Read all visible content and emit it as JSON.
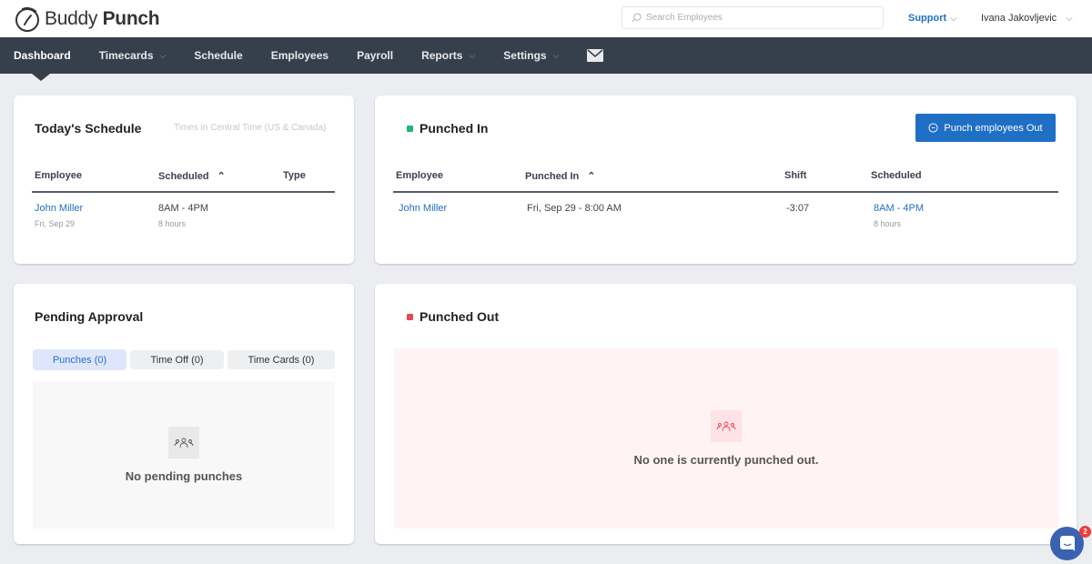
{
  "header": {
    "logo_light": "Buddy ",
    "logo_bold": "Punch",
    "search_placeholder": "Search Employees",
    "support_label": "Support",
    "user_name": "Ivana Jakovljevic"
  },
  "nav": {
    "items": [
      {
        "label": "Dashboard",
        "active": true,
        "dropdown": false
      },
      {
        "label": "Timecards",
        "dropdown": true
      },
      {
        "label": "Schedule",
        "dropdown": false
      },
      {
        "label": "Employees",
        "dropdown": false
      },
      {
        "label": "Payroll",
        "dropdown": false
      },
      {
        "label": "Reports",
        "dropdown": true
      },
      {
        "label": "Settings",
        "dropdown": true
      }
    ],
    "mail_icon": "envelope-icon"
  },
  "todays_schedule": {
    "title": "Today's Schedule",
    "timezone_note": "Times in Central Time (US & Canada)",
    "columns": [
      "Employee",
      "Scheduled",
      "Type"
    ],
    "rows": [
      {
        "employee": "John Miller",
        "date": "Fri, Sep 29",
        "scheduled": "8AM - 4PM",
        "duration": "8 hours",
        "type": ""
      }
    ]
  },
  "punched_in": {
    "title": "Punched In",
    "status_color": "#22b573",
    "button_label": "Punch employees Out",
    "columns": [
      "Employee",
      "Punched In",
      "Shift",
      "Scheduled"
    ],
    "rows": [
      {
        "employee": "John Miller",
        "punched_in": "Fri, Sep 29 - 8:00 AM",
        "shift": "-3:07",
        "scheduled": "8AM - 4PM",
        "duration": "8 hours"
      }
    ]
  },
  "pending_approval": {
    "title": "Pending Approval",
    "tabs": [
      {
        "label": "Punches (0)",
        "active": true
      },
      {
        "label": "Time Off (0)",
        "active": false
      },
      {
        "label": "Time Cards (0)",
        "active": false
      }
    ],
    "empty_text": "No pending punches"
  },
  "punched_out": {
    "title": "Punched Out",
    "status_color": "#e8475a",
    "empty_text": "No one is currently punched out."
  },
  "chat": {
    "badge_count": "2"
  }
}
